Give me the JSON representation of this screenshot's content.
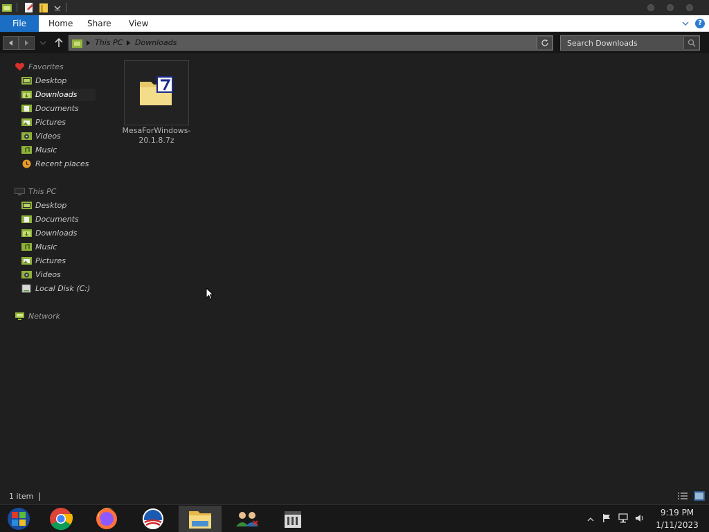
{
  "window": {
    "tabs": {
      "file": "File",
      "home": "Home",
      "share": "Share",
      "view": "View"
    },
    "help_label": "?"
  },
  "address": {
    "crumbs": [
      "This PC",
      "Downloads"
    ],
    "search_placeholder": "Search Downloads"
  },
  "sidebar": {
    "favorites": {
      "label": "Favorites",
      "items": [
        {
          "label": "Desktop",
          "icon": "desktop-icon"
        },
        {
          "label": "Downloads",
          "icon": "downloads-folder-icon",
          "selected": true
        },
        {
          "label": "Documents",
          "icon": "documents-folder-icon"
        },
        {
          "label": "Pictures",
          "icon": "pictures-folder-icon"
        },
        {
          "label": "Videos",
          "icon": "videos-folder-icon"
        },
        {
          "label": "Music",
          "icon": "music-folder-icon"
        },
        {
          "label": "Recent places",
          "icon": "recent-places-icon"
        }
      ]
    },
    "this_pc": {
      "label": "This PC",
      "items": [
        {
          "label": "Desktop",
          "icon": "desktop-icon"
        },
        {
          "label": "Documents",
          "icon": "documents-folder-icon"
        },
        {
          "label": "Downloads",
          "icon": "downloads-folder-icon"
        },
        {
          "label": "Music",
          "icon": "music-folder-icon"
        },
        {
          "label": "Pictures",
          "icon": "pictures-folder-icon"
        },
        {
          "label": "Videos",
          "icon": "videos-folder-icon"
        },
        {
          "label": "Local Disk (C:)",
          "icon": "drive-icon"
        }
      ]
    },
    "network": {
      "label": "Network"
    }
  },
  "files": [
    {
      "name": "MesaForWindows-20.1.8.7z",
      "icon": "7zip-archive-icon"
    }
  ],
  "status": {
    "item_count": "1 item"
  },
  "taskbar": {
    "apps": [
      "start-orb-icon",
      "chrome-icon",
      "firefox-icon",
      "campaign-logo-icon",
      "file-explorer-icon",
      "users-icon",
      "archive-app-icon"
    ],
    "clock_time": "9:19 PM",
    "clock_date": "1/11/2023"
  },
  "colors": {
    "accent": "#1a6fc4",
    "background": "#1f1f1f",
    "folder": "#e8c96a"
  }
}
